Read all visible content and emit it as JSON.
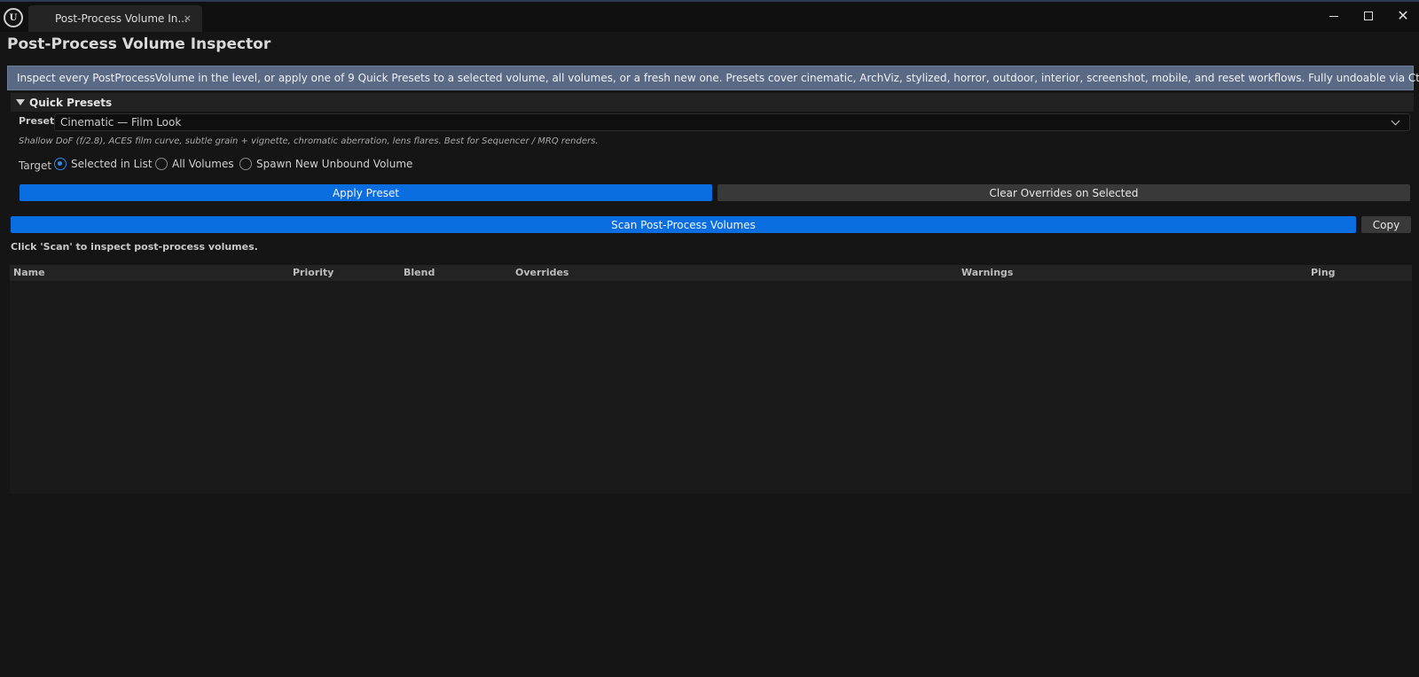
{
  "window": {
    "logo_text": "U",
    "tab_label": "Post-Process Volume In...",
    "tab_close": "×",
    "close_glyph": "✕"
  },
  "page": {
    "title": "Post-Process Volume Inspector",
    "info": "Inspect every PostProcessVolume in the level, or apply one of 9 Quick Presets to a selected volume, all volumes, or a fresh new one. Presets cover cinematic, ArchViz, stylized, horror, outdoor, interior, screenshot, mobile, and reset workflows. Fully undoable via Ctrl+Z."
  },
  "quick_presets": {
    "header": "Quick Presets",
    "preset_label": "Preset",
    "preset_value": "Cinematic — Film Look",
    "preset_description": "Shallow DoF (f/2.8), ACES film curve, subtle grain + vignette, chromatic aberration, lens flares. Best for Sequencer / MRQ renders.",
    "target_label": "Target",
    "targets": [
      {
        "label": "Selected in List",
        "selected": true
      },
      {
        "label": "All Volumes",
        "selected": false
      },
      {
        "label": "Spawn New Unbound Volume",
        "selected": false
      }
    ],
    "apply_label": "Apply Preset",
    "clear_label": "Clear Overrides on Selected"
  },
  "scan": {
    "scan_label": "Scan Post-Process Volumes",
    "copy_label": "Copy",
    "status": "Click 'Scan' to inspect post-process volumes."
  },
  "table": {
    "columns": [
      "Name",
      "Priority",
      "Blend",
      "Overrides",
      "Warnings",
      "Ping"
    ],
    "rows": []
  },
  "colors": {
    "accent": "#0a6ee0",
    "banner": "#5a6a85",
    "background": "#151515"
  },
  "icons": [
    "ue-logo-icon",
    "caret-down-icon",
    "chevron-down-icon",
    "minimize-icon",
    "maximize-icon",
    "close-icon"
  ]
}
